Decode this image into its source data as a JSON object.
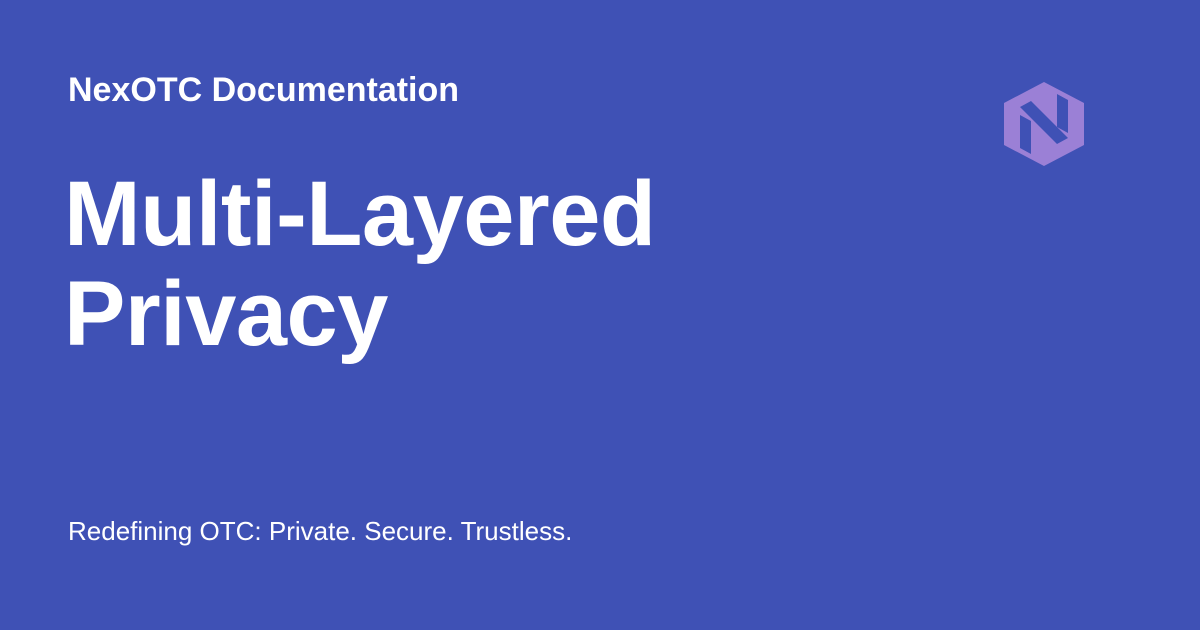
{
  "header": {
    "site_name": "NexOTC Documentation"
  },
  "main": {
    "title_lines": [
      "Multi-Layered",
      "Privacy"
    ]
  },
  "footer": {
    "tagline": "Redefining OTC: Private. Secure. Trustless."
  },
  "logo": {
    "icon": "nexotc-hexagon-logo-icon",
    "color": "#9b80d6"
  },
  "colors": {
    "background": "#3f51b5",
    "text": "#ffffff"
  }
}
